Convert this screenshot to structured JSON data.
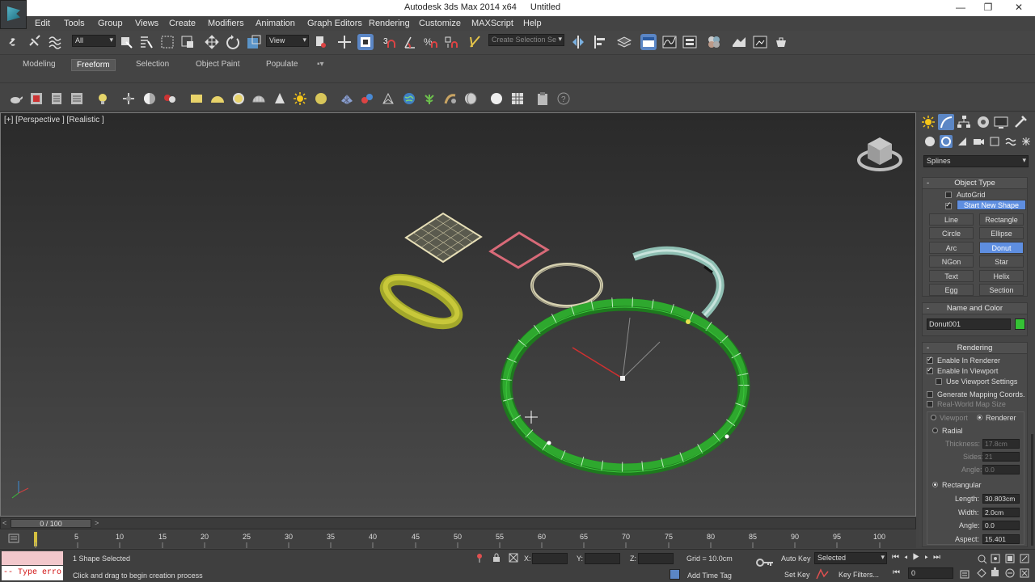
{
  "titlebar": {
    "app": "Autodesk 3ds Max  2014 x64",
    "file": "Untitled",
    "minimize": "—",
    "restore": "❐",
    "close": "✕"
  },
  "menu": [
    "Edit",
    "Tools",
    "Group",
    "Views",
    "Create",
    "Modifiers",
    "Animation",
    "Graph Editors",
    "Rendering",
    "Customize",
    "MAXScript",
    "Help"
  ],
  "toolbar": {
    "filter": "All",
    "refcoord": "View",
    "selset_placeholder": "Create Selection Se"
  },
  "ribbon": {
    "tabs": [
      "Modeling",
      "Freeform",
      "Selection",
      "Object Paint",
      "Populate"
    ],
    "active": "Freeform"
  },
  "viewport": {
    "label": "[+] [Perspective ] [Realistic ]"
  },
  "panel": {
    "category": "Splines",
    "object_type": {
      "title": "Object Type",
      "autogrid": "AutoGrid",
      "start_new_shape": "Start New Shape",
      "buttons": [
        "Line",
        "Rectangle",
        "Circle",
        "Ellipse",
        "Arc",
        "Donut",
        "NGon",
        "Star",
        "Text",
        "Helix",
        "Egg",
        "Section"
      ],
      "active": "Donut"
    },
    "name_color": {
      "title": "Name and Color",
      "name": "Donut001",
      "color": "#35c235"
    },
    "rendering": {
      "title": "Rendering",
      "enable_renderer": "Enable In Renderer",
      "enable_viewport": "Enable In Viewport",
      "use_viewport_settings": "Use Viewport Settings",
      "gen_mapping": "Generate Mapping Coords.",
      "real_world": "Real-World Map Size",
      "viewport": "Viewport",
      "renderer": "Renderer",
      "radial": "Radial",
      "thickness_label": "Thickness:",
      "thickness": "17.8cm",
      "sides_label": "Sides:",
      "sides": "21",
      "angle_label": "Angle:",
      "angle": "0.0",
      "rectangular": "Rectangular",
      "length_label": "Length:",
      "length": "30.803cm",
      "width_label": "Width:",
      "width": "2.0cm",
      "angle2_label": "Angle:",
      "angle2": "0.0",
      "aspect_label": "Aspect:",
      "aspect": "15.401"
    }
  },
  "timeline": {
    "frame": "0 / 100",
    "ticks": [
      "5",
      "10",
      "15",
      "20",
      "25",
      "30",
      "35",
      "40",
      "45",
      "50",
      "55",
      "60",
      "65",
      "70",
      "75",
      "80",
      "85",
      "90",
      "95",
      "100"
    ]
  },
  "status": {
    "script_error": "-- Type erro",
    "selected": "1 Shape Selected",
    "prompt": "Click and drag to begin creation process",
    "x_label": "X:",
    "y_label": "Y:",
    "z_label": "Z:",
    "grid": "Grid = 10.0cm",
    "add_time_tag": "Add Time Tag",
    "auto_key": "Auto Key",
    "set_key": "Set Key",
    "key_mode": "Selected",
    "key_filters": "Key Filters...",
    "frame_field": "0"
  },
  "colors": {
    "accent": "#5b86c5",
    "donut_selected": "#2ea82e",
    "donut_yellow": "#c8c83a",
    "rectangle": "#d86a78",
    "arc_teal": "#8fbfb3"
  }
}
